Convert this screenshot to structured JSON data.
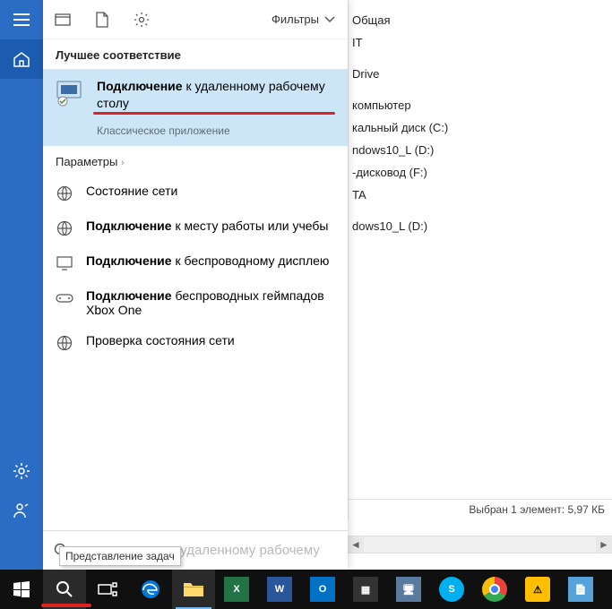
{
  "explorer": {
    "items": [
      "Общая",
      "IT",
      "",
      "Drive",
      "",
      "компьютер",
      "кальный диск (C:)",
      "ndows10_L (D:)",
      "-дисковод (F:)",
      "TA",
      "",
      "dows10_L (D:)"
    ],
    "status": "Выбран 1 элемент: 5,97 КБ"
  },
  "panel": {
    "filters_label": "Фильтры",
    "best_match_header": "Лучшее соответствие",
    "best_match": {
      "title_bold": "Подключение",
      "title_rest": " к удаленному рабочему столу",
      "subtitle": "Классическое приложение"
    },
    "params_label": "Параметры",
    "results": [
      {
        "bold": "",
        "rest": "Состояние сети",
        "icon": "globe-icon"
      },
      {
        "bold": "Подключение",
        "rest": " к месту работы или учебы",
        "icon": "globe-icon"
      },
      {
        "bold": "Подключение",
        "rest": " к беспроводному дисплею",
        "icon": "display-icon"
      },
      {
        "bold": "Подключение",
        "rest": " беспроводных геймпадов Xbox One",
        "icon": "gamepad-icon"
      },
      {
        "bold": "",
        "rest": "Проверка состояния сети",
        "icon": "globe-icon"
      }
    ],
    "search": {
      "typed": "подключение",
      "ghost": " к удаленному рабочему"
    },
    "tooltip": "Представление задач"
  },
  "colors": {
    "rail": "#2b6cc4",
    "highlight": "#cde6f7",
    "red": "#d22"
  }
}
